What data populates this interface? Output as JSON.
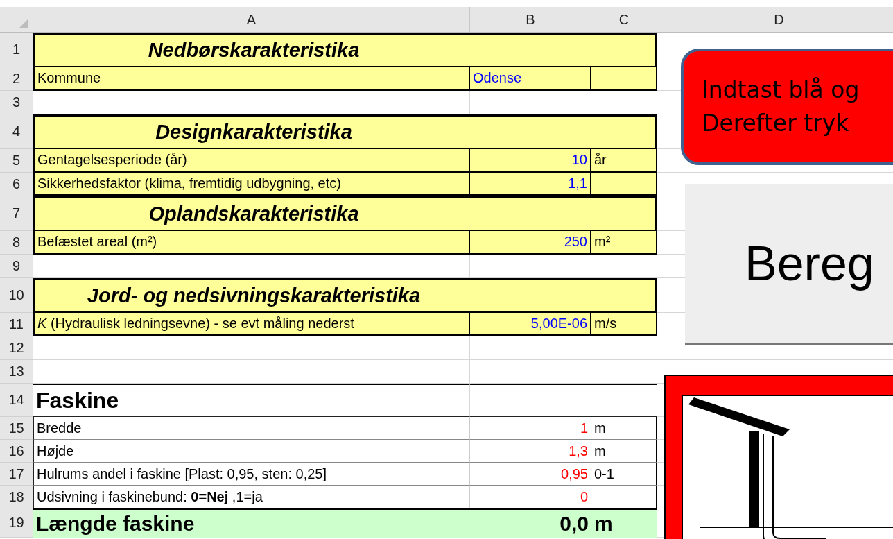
{
  "sheet": {
    "columns": [
      "A",
      "B",
      "C",
      "D"
    ],
    "rows": [
      {
        "number": "1",
        "kind": "section",
        "label": "Nedbørskarakteristika"
      },
      {
        "number": "2",
        "kind": "text_input",
        "label": "Kommune",
        "value": "Odense",
        "color": "#0000ff"
      },
      {
        "number": "3",
        "kind": "blank"
      },
      {
        "number": "4",
        "kind": "section",
        "label": "Designkarakteristika"
      },
      {
        "number": "5",
        "kind": "input",
        "label": "Gentagelsesperiode (år)",
        "value": "10",
        "color": "#0000ff",
        "unit": "år"
      },
      {
        "number": "6",
        "kind": "input",
        "label": "Sikkerhedsfaktor (klima, fremtidig udbygning, etc)",
        "value": "1,1",
        "color": "#0000ff"
      },
      {
        "number": "7",
        "kind": "section",
        "label": "Oplandskarakteristika"
      },
      {
        "number": "8",
        "kind": "input",
        "label": "Befæstet areal (m²)",
        "value": "250",
        "color": "#0000ff",
        "unit": "m²"
      },
      {
        "number": "9",
        "kind": "blank"
      },
      {
        "number": "10",
        "kind": "section",
        "label": "Jord- og nedsivningskarakteristika"
      },
      {
        "number": "11",
        "kind": "input",
        "label": "*K* (Hydraulisk  ledningsevne) - se evt måling nederst",
        "value": "5,00E-06",
        "color": "#0000ff",
        "unit": "m/s"
      },
      {
        "number": "12",
        "kind": "blank"
      },
      {
        "number": "13",
        "kind": "blank"
      },
      {
        "number": "14",
        "kind": "title",
        "label": "Faskine"
      },
      {
        "number": "15",
        "kind": "param",
        "label": "Bredde",
        "value": "1",
        "color": "#ff0000",
        "unit": "m"
      },
      {
        "number": "16",
        "kind": "param",
        "label": "Højde",
        "value": "1,3",
        "color": "#ff0000",
        "unit": "m"
      },
      {
        "number": "17",
        "kind": "param",
        "label": "Hulrums andel i faskine [Plast: 0,95, sten: 0,25]",
        "value": "0,95",
        "color": "#ff0000",
        "unit": "0-1"
      },
      {
        "number": "18",
        "kind": "param",
        "label": "Udsivning i faskinebund: **0=Nej** ,1=ja",
        "value": "0",
        "color": "#ff0000"
      },
      {
        "number": "19",
        "kind": "result",
        "label": "Længde faskine",
        "value": "0,0",
        "color": "#000000",
        "unit": "m"
      }
    ]
  },
  "callout": {
    "lines": [
      "Indtast blå og",
      "Derefter tryk"
    ]
  },
  "button": {
    "label": "Bereg"
  }
}
